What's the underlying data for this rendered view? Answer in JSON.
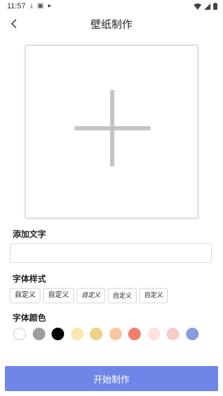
{
  "status_bar": {
    "time": "11:57"
  },
  "header": {
    "title": "壁纸制作"
  },
  "sections": {
    "add_text_label": "添加文字",
    "font_style_label": "字体样式",
    "font_color_label": "字体颜色"
  },
  "text_input": {
    "value": "",
    "placeholder": ""
  },
  "font_options": [
    "自定义",
    "自定义",
    "自定义",
    "自定义",
    "自定义"
  ],
  "colors": [
    "#ffffff",
    "#9e9e9e",
    "#000000",
    "#fde7b0",
    "#f0d082",
    "#f7c6a0",
    "#ef7f6c",
    "#fde4e0",
    "#f8cbc6",
    "#889de0"
  ],
  "start_button": {
    "label": "开始制作"
  }
}
